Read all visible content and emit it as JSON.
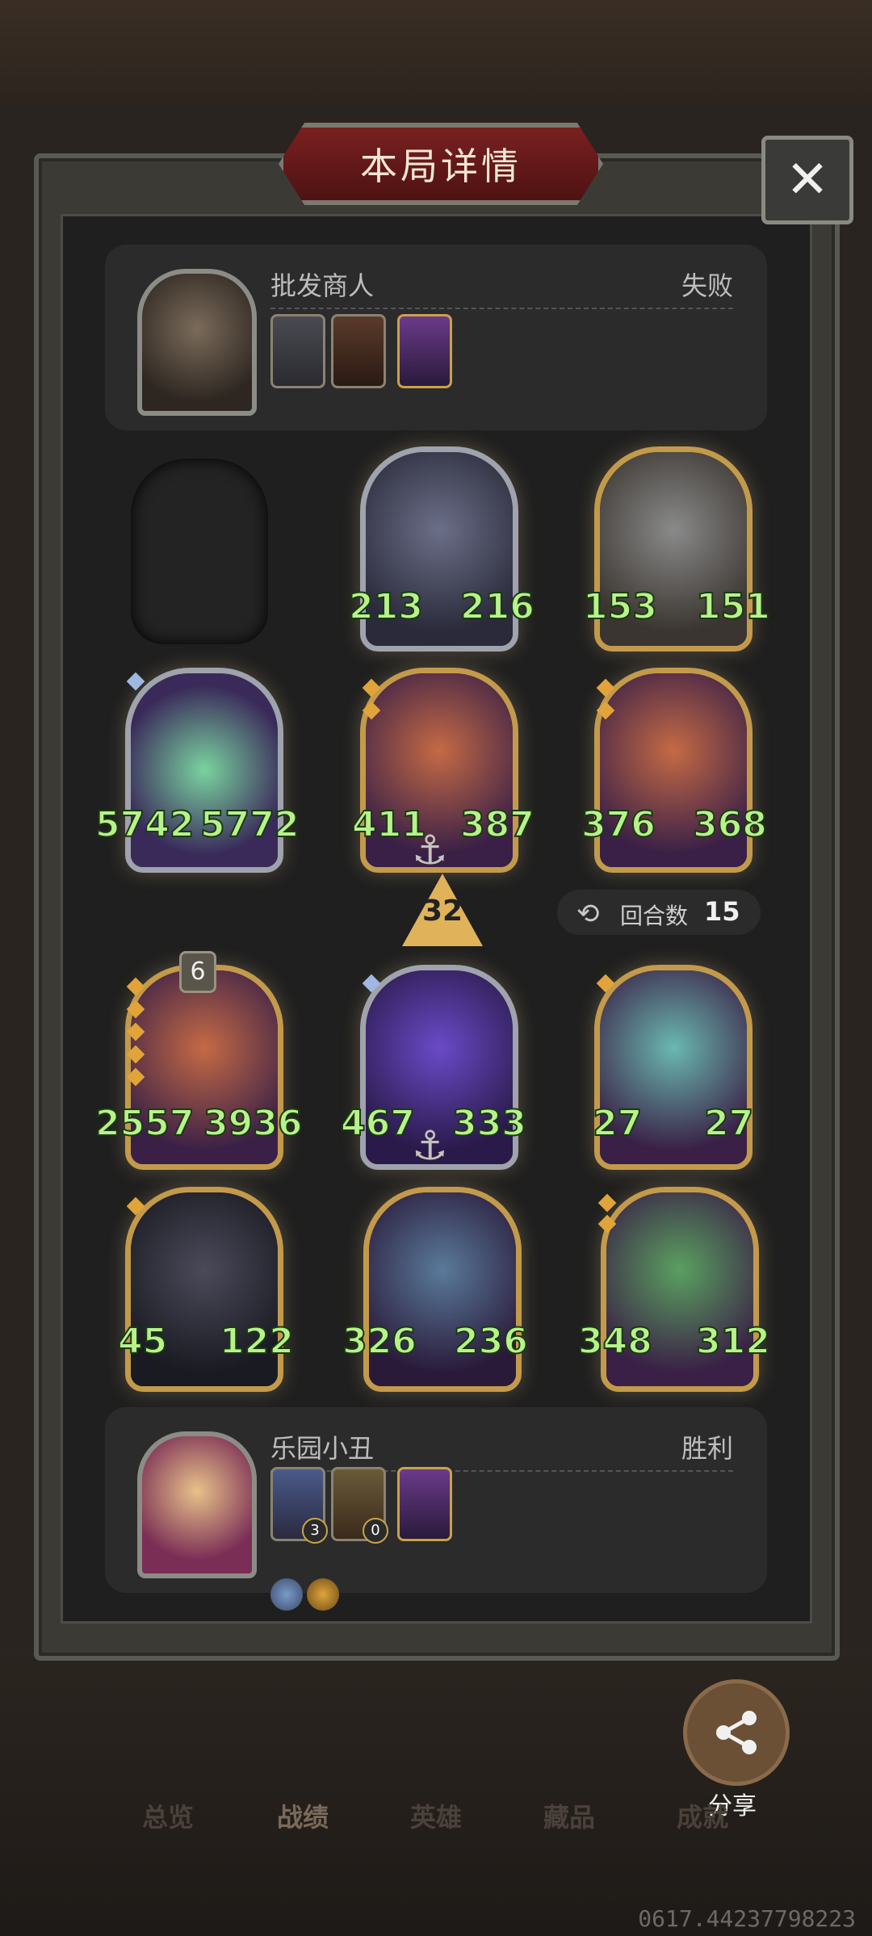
{
  "header": {
    "title": "本局详情",
    "close_label": "✕"
  },
  "opponent": {
    "name": "批发商人",
    "result": "失败",
    "avatar_icon": "cat-hero-avatar"
  },
  "me": {
    "name": "乐园小丑",
    "result": "胜利",
    "avatar_icon": "clown-hero-avatar",
    "item_badges": [
      "3",
      "0"
    ]
  },
  "board_opponent": [
    {
      "icon": "elf-sorceress",
      "attack": "213",
      "health": "216"
    },
    {
      "icon": "windmill",
      "attack": "153",
      "health": "151"
    },
    {
      "icon": "shark-mech",
      "attack": "5742",
      "health": "5772"
    },
    {
      "icon": "archer",
      "attack": "411",
      "health": "387"
    },
    {
      "icon": "archer",
      "attack": "376",
      "health": "368"
    }
  ],
  "board_me": [
    {
      "icon": "archer",
      "attack": "2557",
      "health": "3936",
      "level_badge": "6"
    },
    {
      "icon": "purple-dragon",
      "attack": "467",
      "health": "333"
    },
    {
      "icon": "serpent-dragon",
      "attack": "27",
      "health": "27"
    },
    {
      "icon": "black-dragon",
      "attack": "45",
      "health": "122"
    },
    {
      "icon": "gargoyle",
      "attack": "326",
      "health": "236"
    },
    {
      "icon": "crocodile",
      "attack": "348",
      "health": "312"
    }
  ],
  "turn": {
    "damage": "32",
    "round_label": "回合数",
    "round_value": "15"
  },
  "share": {
    "label": "分享"
  },
  "tabs": [
    "总览",
    "战绩",
    "英雄",
    "藏品",
    "成就"
  ],
  "footer": {
    "code": "0617.44237798223"
  },
  "colors": {
    "stat_green": "#b8f28a",
    "gold_frame": "#c39a4c",
    "title_red": "#7a2020"
  }
}
